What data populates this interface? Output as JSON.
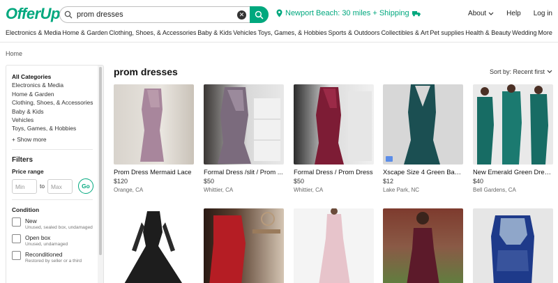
{
  "header": {
    "logo": "OfferUp",
    "search_value": "prom dresses",
    "location": "Newport Beach: 30 miles + Shipping",
    "nav": [
      "About",
      "Help",
      "Log in"
    ]
  },
  "categories": [
    "Electronics & Media",
    "Home & Garden",
    "Clothing, Shoes, & Accessories",
    "Baby & Kids",
    "Vehicles",
    "Toys, Games, & Hobbies",
    "Sports & Outdoors",
    "Collectibles & Art",
    "Pet supplies",
    "Health & Beauty",
    "Wedding",
    "More"
  ],
  "breadcrumb": "Home",
  "sidebar": {
    "all_categories": "All Categories",
    "cats": [
      "Electronics & Media",
      "Home & Garden",
      "Clothing, Shoes, & Accessories",
      "Baby & Kids",
      "Vehicles",
      "Toys, Games, & Hobbies"
    ],
    "show_more": "+ Show more",
    "filters": "Filters",
    "price_range": "Price range",
    "min_placeholder": "Min",
    "to": "to",
    "max_placeholder": "Max",
    "go": "Go",
    "condition": "Condition",
    "conditions": [
      {
        "title": "New",
        "sub": "Unused, sealed box, undamaged"
      },
      {
        "title": "Open box",
        "sub": "Unused, undamaged"
      },
      {
        "title": "Reconditioned",
        "sub": "Restored by seller or a third"
      }
    ]
  },
  "main": {
    "title": "prom dresses",
    "sort": "Sort by: Recent first",
    "listings": [
      {
        "title": "Prom Dress Mermaid Lace",
        "price": "$120",
        "location": "Orange, CA"
      },
      {
        "title": "Formal Dress /slit / Prom ...",
        "price": "$50",
        "location": "Whittier, CA"
      },
      {
        "title": "Formal Dress / Prom Dress",
        "price": "$50",
        "location": "Whittier, CA"
      },
      {
        "title": "Xscape Size 4 Green Back ...",
        "price": "$12",
        "location": "Lake Park, NC"
      },
      {
        "title": "New Emerald Green Dress...",
        "price": "$40",
        "location": "Bell Gardens, CA"
      }
    ]
  },
  "colors": {
    "brand": "#00a87e"
  }
}
